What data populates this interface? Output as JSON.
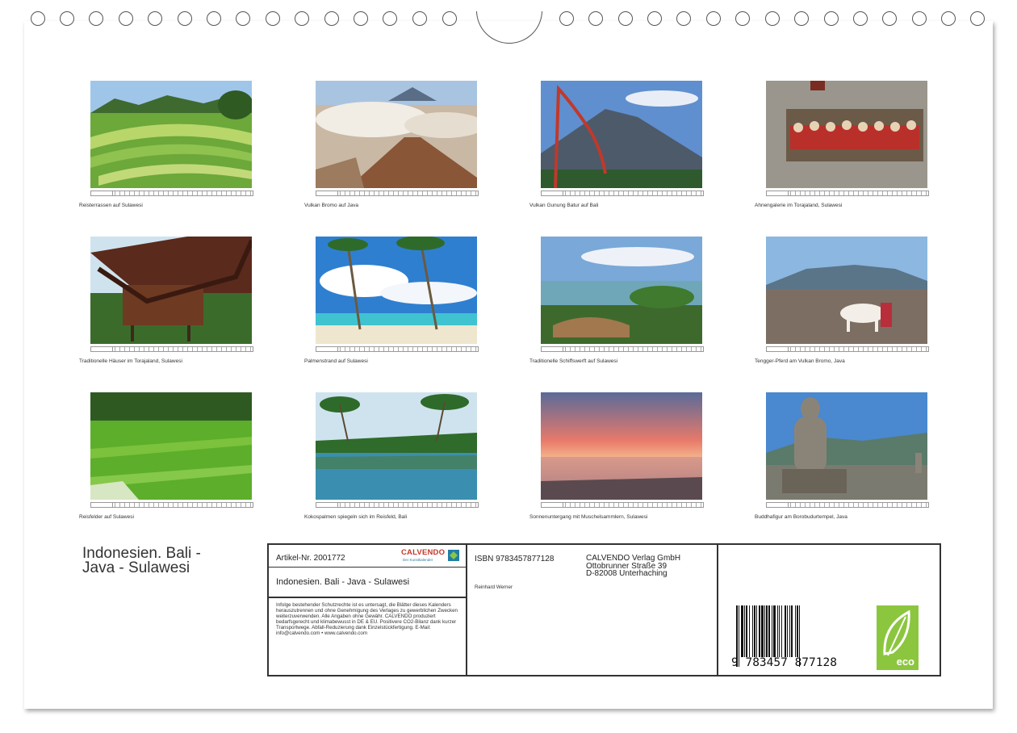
{
  "calendar": {
    "title": "Indonesien. Bali - Java - Sulawesi",
    "title_line1": "Indonesien. Bali -",
    "title_line2": "Java - Sulawesi"
  },
  "months": [
    {
      "caption": "Reisterrassen auf Sulawesi",
      "scene": "rice-terraces"
    },
    {
      "caption": "Vulkan Bromo auf Java",
      "scene": "volcano-bromo"
    },
    {
      "caption": "Vulkan Gunung Batur auf Bali",
      "scene": "volcano-batur"
    },
    {
      "caption": "Ahnengalerie im Torajaland, Sulawesi",
      "scene": "ancestor-gallery"
    },
    {
      "caption": "Traditionelle Häuser im Torajaland, Sulawesi",
      "scene": "toraja-houses"
    },
    {
      "caption": "Palmenstrand auf Sulawesi",
      "scene": "palm-beach"
    },
    {
      "caption": "Traditionelle Schiffswerft auf Sulawesi",
      "scene": "shipyard"
    },
    {
      "caption": "Tengger-Pferd am Vulkan Bromo, Java",
      "scene": "horse-bromo"
    },
    {
      "caption": "Reisfelder auf Sulawesi",
      "scene": "rice-field"
    },
    {
      "caption": "Kokospalmen spiegeln sich im Reisfeld, Bali",
      "scene": "palm-reflection"
    },
    {
      "caption": "Sonnenuntergang mit Muschelsammlern, Sulawesi",
      "scene": "sunset"
    },
    {
      "caption": "Buddhafigur am Borobudurtempel, Java",
      "scene": "borobudur-buddha"
    }
  ],
  "info": {
    "artikel": "Artikel-Nr. 2001772",
    "logo_text": "CALVENDO",
    "logo_sub": "Der Kunstkalender",
    "book_title": "Indonesien. Bali - Java - Sulawesi",
    "legal": "Infolge bestehender Schutzrechte ist es untersagt, die Blätter dieses Kalenders herauszutrennen und ohne Genehmigung des Verlages zu gewerblichen Zwecken weiterzuverwenden. Alle Angaben ohne Gewähr. CALVENDO produziert bedarfsgerecht und klimabewusst in DE & EU. Positivere CO2-Bilanz dank kurzer Transportwege. Abfall-Reduzierung dank Einzelstückfertigung. E-Mail: info@calvendo.com • www.calvendo.com",
    "isbn": "ISBN 9783457877128",
    "author": "Reinhard Werner",
    "publisher_name": "CALVENDO Verlag GmbH",
    "publisher_street": "Ottobrunner Straße 39",
    "publisher_city": "D-82008 Unterhaching",
    "barcode_digits": "9 783457 877128",
    "eco_label": "eco",
    "eco_color": "#8cc63f"
  }
}
